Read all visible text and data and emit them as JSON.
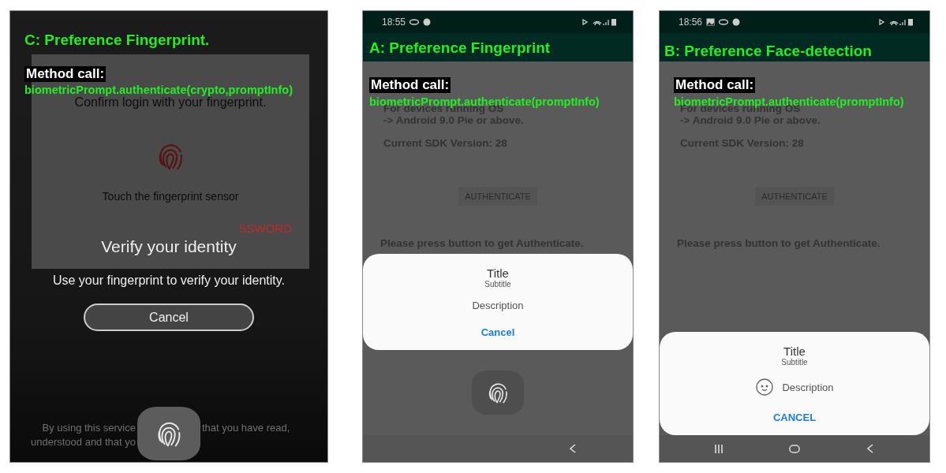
{
  "panels": [
    {
      "kind": "overlay",
      "annotation": {
        "heading": "C: Preference Fingerprint.",
        "label": "Method call:",
        "code": "biometricPrompt.authenticate(crypto,promptInfo)"
      },
      "background_card": {
        "text": "Confirm login with your fingerprint.",
        "hint": "Touch the fingerprint sensor",
        "button_fragment": "SSWORD"
      },
      "prompt": {
        "title": "Verify your identity",
        "message": "Use your fingerprint to verify your identity.",
        "cancel": "Cancel"
      },
      "legal": [
        [
          "By using this service",
          "that you have read,"
        ],
        [
          "understood and that yo"
        ]
      ]
    },
    {
      "kind": "app",
      "status_bar": {
        "time": "18:55",
        "gallery_notification": false
      },
      "annotation": {
        "heading": "A: Preference Fingerprint",
        "label": "Method call:",
        "code": "biometricPrompt.authenticate(promptInfo)"
      },
      "body": {
        "lines": [
          "For devices running OS",
          "-> Android 9.0 Pie or above."
        ],
        "sdk": "Current SDK Version: 28",
        "button": "AUTHENTICATE",
        "status": "Please press button to get Authenticate."
      },
      "dialog": {
        "title": "Title",
        "subtitle": "Subtitle",
        "description": "Description",
        "cancel": "Cancel",
        "face_icon": false,
        "docked": false
      },
      "sensor": true,
      "full_navigation": false
    },
    {
      "kind": "app",
      "status_bar": {
        "time": "18:56",
        "gallery_notification": true
      },
      "annotation": {
        "heading": "B: Preference Face-detection",
        "label": "Method call:",
        "code": "biometricPrompt.authenticate(promptInfo)"
      },
      "body": {
        "lines": [
          "For devices running OS",
          "-> Android 9.0 Pie or above."
        ],
        "sdk": "Current SDK Version: 28",
        "button": "AUTHENTICATE",
        "status": "Please press button to get Authenticate."
      },
      "dialog": {
        "title": "Title",
        "subtitle": "Subtitle",
        "description": "Description",
        "cancel": "CANCEL",
        "face_icon": true,
        "docked": true
      },
      "sensor": false,
      "full_navigation": true
    }
  ]
}
